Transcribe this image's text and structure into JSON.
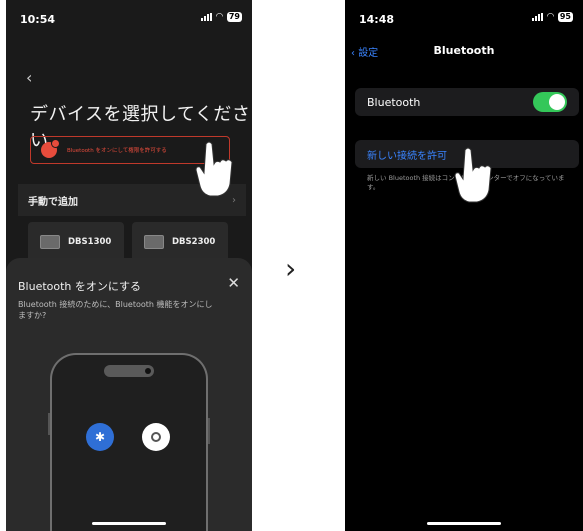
{
  "left_phone": {
    "status": {
      "time": "10:54",
      "battery": "79"
    },
    "title": "デバイスを選択してください",
    "bt_banner": "Bluetooth をオンにして権限を許可する",
    "manual_add": "手動で追加",
    "devices": [
      "DBS1300",
      "DBS2300"
    ],
    "sheet": {
      "title": "Bluetooth をオンにする",
      "description": "Bluetooth 接続のために、Bluetooth 機能をオンにしますか?"
    }
  },
  "right_phone": {
    "status": {
      "time": "14:48",
      "battery": "95"
    },
    "back_label": "設定",
    "title": "Bluetooth",
    "bluetooth_row": "Bluetooth",
    "bluetooth_on": true,
    "allow_new": "新しい接続を許可",
    "footnote": "新しい Bluetooth 接続はコントロールセンターでオフになっています。"
  },
  "colors": {
    "toggle": "#34c759",
    "link": "#3a84ff",
    "warn": "#e74c3c"
  },
  "icons": [
    "back-chevron-icon",
    "bluetooth-icon",
    "location-icon",
    "close-icon",
    "hand-pointer-icon",
    "arrow-right-icon"
  ]
}
